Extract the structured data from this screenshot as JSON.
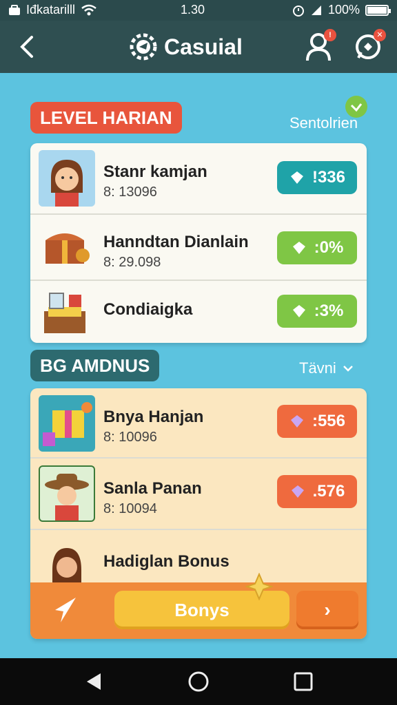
{
  "status_bar": {
    "carrier": "Iđkatarilll",
    "time": "1.30",
    "battery": "100%",
    "battery_level": 1.0
  },
  "header": {
    "title": "Casuial",
    "notification_badge": "!"
  },
  "level_section": {
    "label": "LEVEL HARIAN",
    "link": "Sentolrien",
    "rows": [
      {
        "title": "Stanr kamjan",
        "sub": "8: 13096",
        "pill": "!336",
        "pill_color": "#1fa3a8"
      },
      {
        "title": "Hanndtan Dianlain",
        "sub": "8: 29.098",
        "pill": ":0%",
        "pill_color": "#7fc645"
      },
      {
        "title": "Condiaigka",
        "sub": "",
        "pill": ":3%",
        "pill_color": "#7fc645"
      }
    ]
  },
  "bonus_section": {
    "label": "BG AMDNUS",
    "link": "Tävni",
    "rows": [
      {
        "title": "Bnya Hanjan",
        "sub": "8: 10096",
        "pill": ":556",
        "pill_color": "#ef6a3e"
      },
      {
        "title": "Sanla Panan",
        "sub": "8: 10094",
        "pill": ".576",
        "pill_color": "#ef6a3e"
      },
      {
        "title": "Hadiglan Bonus",
        "sub": ""
      }
    ],
    "cta": "Bonys",
    "next": "›"
  },
  "colors": {
    "background": "#5cc3df",
    "header": "#2f4f51",
    "accent_orange": "#f08a3a",
    "label_red": "#e8553c",
    "label_teal": "#2d6a6f"
  }
}
